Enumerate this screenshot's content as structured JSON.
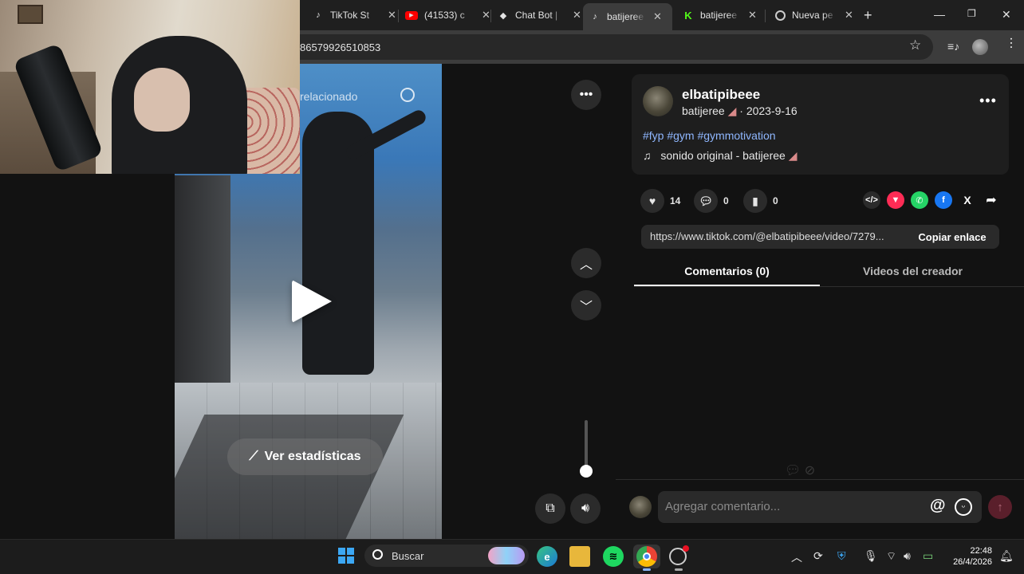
{
  "browser": {
    "tabs": [
      {
        "icon": "tiktok-icon",
        "label": "TikTok St",
        "active": false
      },
      {
        "icon": "youtube-icon",
        "label": "(41533) c",
        "active": false
      },
      {
        "icon": "chatbot-icon",
        "label": "Chat Bot |",
        "active": false
      },
      {
        "icon": "tiktok-icon",
        "label": "batijeree",
        "active": true
      },
      {
        "icon": "kick-icon",
        "label": "batijeree",
        "active": false
      },
      {
        "icon": "chrome-icon",
        "label": "Nueva pe",
        "active": false
      }
    ],
    "new_tab": "+",
    "url": "86579926510853"
  },
  "video": {
    "search_text": "relacionado",
    "stats_button": "Ver estadísticas"
  },
  "post": {
    "username": "elbatipibeee",
    "nickname": "batijeree",
    "date": "2023-9-16",
    "hashtags": "#fyp #gym #gymmotivation",
    "sound": "sonido original - batijeree",
    "likes": "14",
    "comments": "0",
    "saves": "0",
    "link": "https://www.tiktok.com/@elbatipibeee/video/7279...",
    "copy_label": "Copiar enlace",
    "tab_comments": "Comentarios (0)",
    "tab_videos": "Videos del creador",
    "comment_placeholder": "Agregar comentario..."
  },
  "taskbar": {
    "search_label": "Buscar",
    "time": "22:48",
    "date": "26/4/2026"
  },
  "colors": {
    "accent_link": "#8fb7ff",
    "tiktok_red": "#fe2c55",
    "whatsapp": "#25d366",
    "facebook": "#1877f2"
  }
}
